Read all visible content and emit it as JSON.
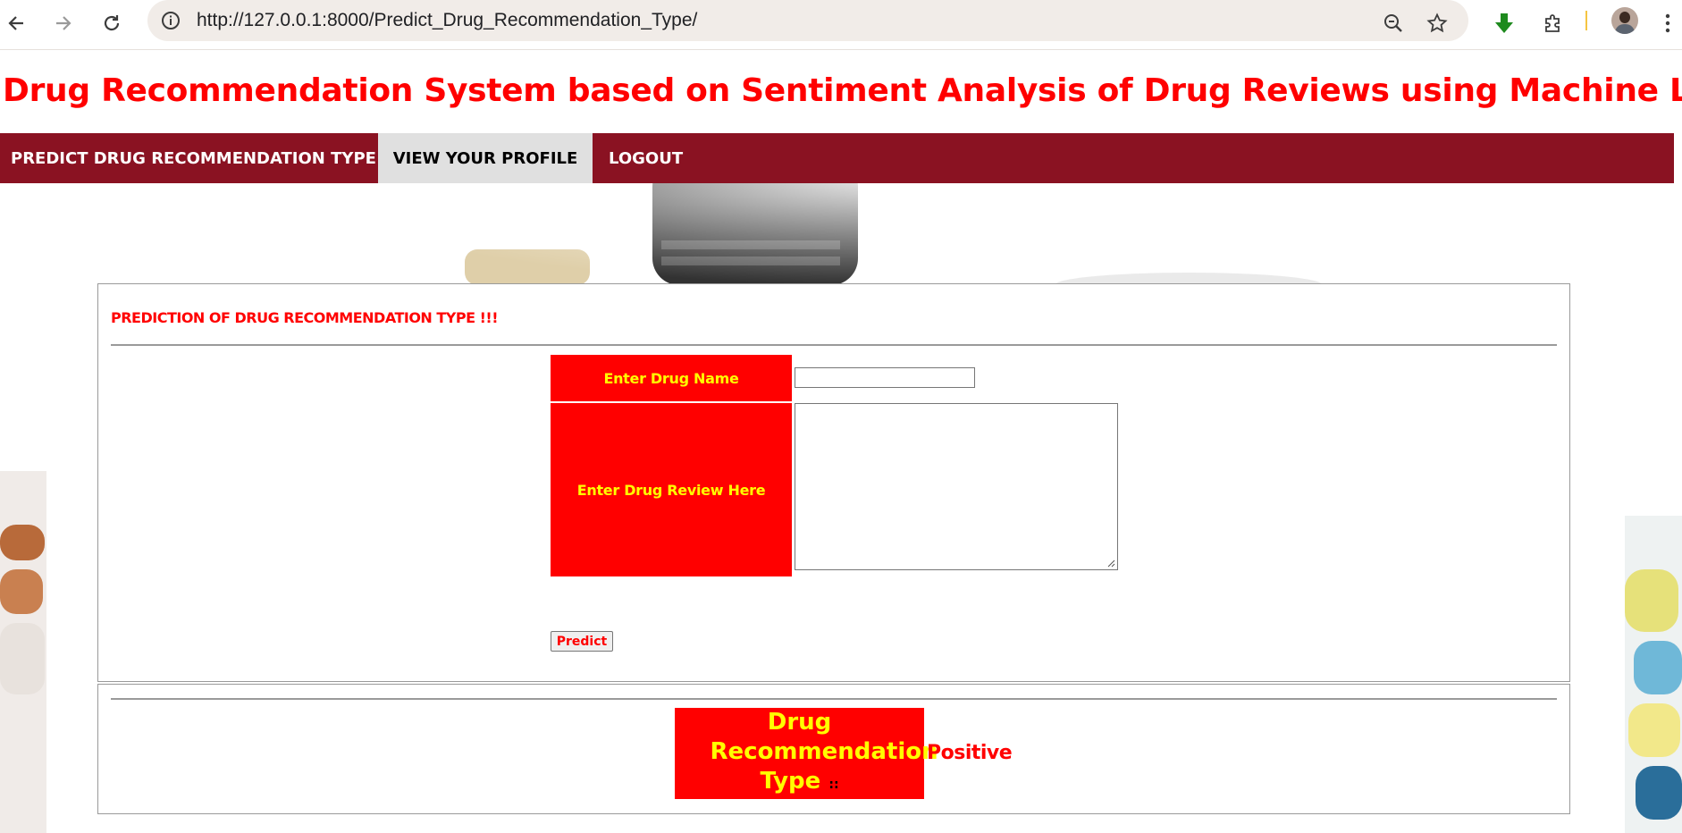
{
  "browser": {
    "url": "http://127.0.0.1:8000/Predict_Drug_Recommendation_Type/",
    "icons": [
      "back-icon",
      "forward-icon",
      "reload-icon",
      "site-info-icon",
      "zoom-icon",
      "star-icon",
      "download-icon",
      "extensions-icon",
      "avatar",
      "menu-icon"
    ]
  },
  "header": {
    "title": "Drug Recommendation System based on Sentiment Analysis of Drug Reviews using Machine Learning"
  },
  "menu": {
    "items": [
      {
        "label": "PREDICT DRUG RECOMMENDATION TYPE",
        "active": false
      },
      {
        "label": "VIEW YOUR PROFILE",
        "active": true
      },
      {
        "label": "LOGOUT",
        "active": false
      }
    ]
  },
  "form": {
    "heading": "PREDICTION OF DRUG RECOMMENDATION TYPE !!!",
    "drug_name_label": "Enter Drug Name",
    "drug_name_value": "",
    "review_label": "Enter Drug Review Here",
    "review_value": "",
    "submit_label": "Predict"
  },
  "result": {
    "label": "Drug Recommendation Type",
    "colon": "::",
    "value": "Positive"
  },
  "colors": {
    "accent_red": "#ff0000",
    "label_text_yellow": "#ffff00",
    "menubar": "#8a1222",
    "menu_active_bg": "#e0e0e0"
  }
}
